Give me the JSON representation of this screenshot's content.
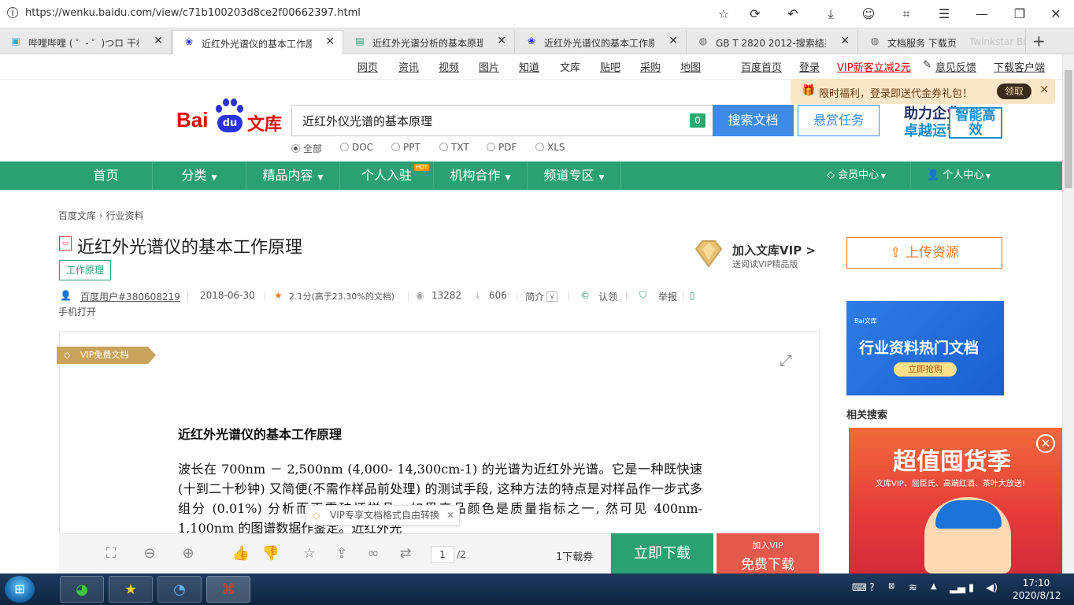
{
  "browser": {
    "url": "https://wenku.baidu.com/view/c71b100203d8ce2f00662397.html",
    "tabs": [
      {
        "icon": "bilibili-icon",
        "title": "哔哩哔哩 ( ゜- ゜)つロ 干杯"
      },
      {
        "icon": "baidu-paw-icon",
        "title": "近红外光谱仪的基本工作原"
      },
      {
        "icon": "doc-icon",
        "title": "近红外光谱分析的基本原理"
      },
      {
        "icon": "baidu-paw-icon",
        "title": "近红外光谱仪的基本工作原"
      },
      {
        "icon": "globe-icon",
        "title": "GB T 2820 2012-搜索结果"
      },
      {
        "icon": "globe-icon",
        "title": "文档服务 下载页"
      }
    ],
    "tab_overflow": "Twinkstar Br",
    "new_tab": "+"
  },
  "top_links": {
    "left": [
      "网页",
      "资讯",
      "视频",
      "图片",
      "知道",
      "文库",
      "贴吧",
      "采购",
      "地图"
    ],
    "right": [
      "百度首页",
      "登录",
      "VIP新客立减2元",
      "意见反馈",
      "下载客户端"
    ]
  },
  "logo": {
    "bai": "Bai",
    "du": "du",
    "wenku": "文库"
  },
  "search": {
    "query": "近红外仪光谱的基本原理",
    "count": "0",
    "button": "搜索文档",
    "reward": "悬赏任务",
    "filters": [
      "全部",
      "DOC",
      "PPT",
      "TXT",
      "PDF",
      "XLS"
    ],
    "selected": "全部"
  },
  "promo": {
    "line1": "助力企业",
    "line2": "卓越运营",
    "box": "智能高效"
  },
  "coupon_tip": {
    "text": "限时福利，登录即送代金券礼包！",
    "button": "领取",
    "close": "×"
  },
  "nav": {
    "items": [
      "首页",
      "分类",
      "精品内容",
      "个人入驻",
      "机构合作",
      "频道专区"
    ],
    "hot": "HOT",
    "right": [
      "会员中心",
      "个人中心"
    ]
  },
  "breadcrumb": [
    "百度文库",
    "行业资料"
  ],
  "doc": {
    "title": "近红外光谱仪的基本工作原理",
    "tag": "工作原理",
    "author": "百度用户#380608219",
    "date": "2018-06-30",
    "rating": "2.1分(高于23.30%的文档)",
    "views": "13282",
    "downloads": "606",
    "intro": "简介",
    "claim": "认领",
    "report": "举报",
    "phone_open": "手机打开"
  },
  "vip": {
    "join": "加入文库VIP >",
    "sub": "送阅读VIP精品版"
  },
  "upload": "上传资源",
  "ads": {
    "blue_logo": "Bai文库",
    "blue_title": "行业资料热门文档",
    "blue_btn": "立即抢购",
    "red_title": "超值囤货季",
    "red_sub": "文库VIP、屈臣氏、高端红酒、茶叶大放送!"
  },
  "related_title": "相关搜索",
  "viewer": {
    "ribbon": "VIP免费文档",
    "heading": "近红外光谱仪的基本工作原理",
    "paragraph": "波长在 700nm － 2,500nm (4,000- 14,300cm-1) 的光谱为近红外光谱。它是一种既快速(十到二十秒钟) 又简便(不需作样品前处理) 的测试手段, 这种方法的特点是对样品作一步式多组分 (0.01%) 分析而不需破坏样品。如果产品颜色是质量指标之一, 然可见 400nm-1,100nm 的图谱数据作鉴定。近红外光",
    "format_tip": "VIP专享文档格式自由转换",
    "page_current": "1",
    "page_total": "/2",
    "coupon": "1下载券",
    "download_now": "立即下载",
    "vip_join": "加入VIP",
    "vip_free": "免费下载"
  },
  "taskbar": {
    "time": "17:10",
    "date": "2020/8/12"
  }
}
